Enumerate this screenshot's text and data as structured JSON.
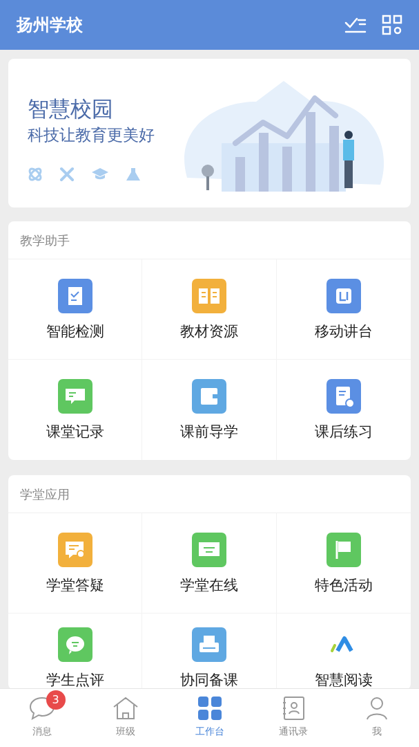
{
  "header": {
    "title": "扬州学校"
  },
  "banner": {
    "title": "智慧校园",
    "subtitle": "科技让教育更美好"
  },
  "sections": [
    {
      "title": "教学助手",
      "items": [
        {
          "label": "智能检测",
          "color": "#5b8fe3"
        },
        {
          "label": "教材资源",
          "color": "#f2b03c"
        },
        {
          "label": "移动讲台",
          "color": "#5b8fe3"
        },
        {
          "label": "课堂记录",
          "color": "#5fc760"
        },
        {
          "label": "课前导学",
          "color": "#5fa8e2"
        },
        {
          "label": "课后练习",
          "color": "#5b8fe3"
        }
      ]
    },
    {
      "title": "学堂应用",
      "items": [
        {
          "label": "学堂答疑",
          "color": "#f2b03c"
        },
        {
          "label": "学堂在线",
          "color": "#5fc760"
        },
        {
          "label": "特色活动",
          "color": "#5fc760"
        },
        {
          "label": "学生点评",
          "color": "#5fc760"
        },
        {
          "label": "协同备课",
          "color": "#5fa8e2"
        },
        {
          "label": "智慧阅读"
        }
      ]
    }
  ],
  "nav": [
    {
      "label": "消息",
      "selected": false,
      "badge": "3"
    },
    {
      "label": "班级",
      "selected": false
    },
    {
      "label": "工作台",
      "selected": true
    },
    {
      "label": "通讯录",
      "selected": false
    },
    {
      "label": "我",
      "selected": false
    }
  ]
}
